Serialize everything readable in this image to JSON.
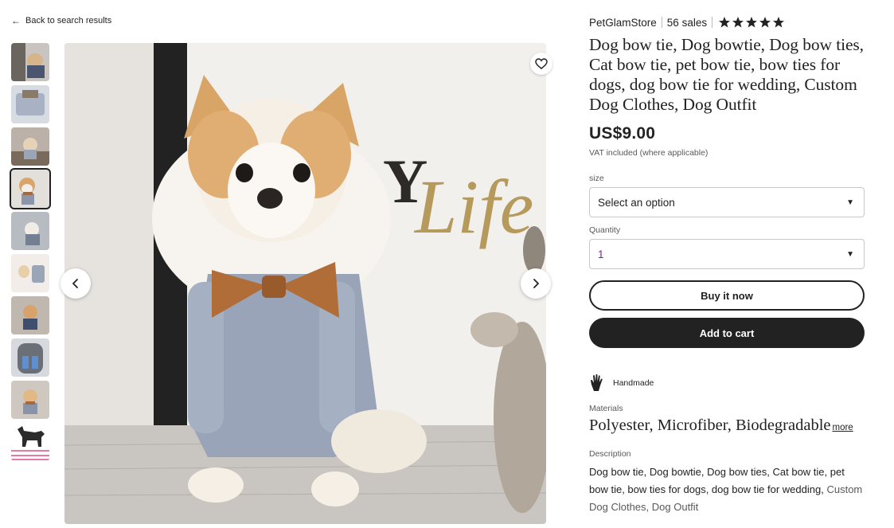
{
  "nav": {
    "back_label": "Back to search results"
  },
  "gallery": {
    "thumb_count": 10,
    "active_index": 3
  },
  "shop": {
    "name": "PetGlamStore",
    "sales": "56 sales",
    "rating_stars": 5
  },
  "product": {
    "title": "Dog bow tie, Dog bowtie, Dog bow ties, Cat bow tie, pet bow tie, bow ties for dogs, dog bow tie for wedding, Custom Dog Clothes, Dog Outfit",
    "price": "US$9.00",
    "vat_note": "VAT included (where applicable)"
  },
  "options": {
    "size_label": "size",
    "size_value": "Select an option",
    "quantity_label": "Quantity",
    "quantity_value": "1"
  },
  "actions": {
    "buy_now": "Buy it now",
    "add_to_cart": "Add to cart"
  },
  "details": {
    "handmade_label": "Handmade",
    "materials_label": "Materials",
    "materials_value": "Polyester, Microfiber, Biodegradable",
    "more_label": "more",
    "description_label": "Description",
    "description_main": "Dog bow tie, Dog bowtie, Dog bow ties, Cat bow tie, pet bow tie, bow ties for dogs, dog bow tie for wedding,",
    "description_faded": "Custom Dog Clothes, Dog Outfit"
  },
  "image_text": {
    "sign_text": "Life",
    "sign_letter": "Y"
  },
  "colors": {
    "primary": "#222222",
    "muted": "#595959",
    "quantity_accent": "#7a1fa2"
  }
}
